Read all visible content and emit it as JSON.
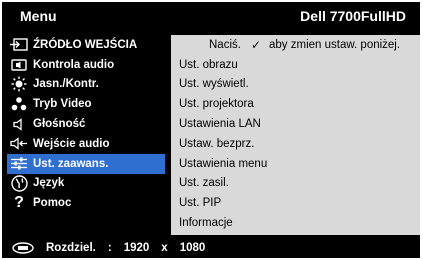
{
  "header": {
    "title": "Menu",
    "model": "Dell 7700FullHD"
  },
  "left_menu": [
    {
      "label": "ŹRÓDŁO WEJŚCIA",
      "icon": "input-source-icon"
    },
    {
      "label": "Kontrola audio",
      "icon": "audio-control-icon"
    },
    {
      "label": "Jasn./Kontr.",
      "icon": "brightness-icon"
    },
    {
      "label": "Tryb Video",
      "icon": "video-mode-icon"
    },
    {
      "label": "Głośność",
      "icon": "speaker-icon"
    },
    {
      "label": "Wejście audio",
      "icon": "audio-input-icon"
    },
    {
      "label": "Ust. zaawans.",
      "icon": "advanced-settings-icon",
      "selected": true
    },
    {
      "label": "Język",
      "icon": "globe-icon"
    },
    {
      "label": "Pomoc",
      "icon": "help-icon"
    }
  ],
  "right_options": {
    "hint_prefix": "Naciś.",
    "hint_suffix": "aby zmien ustaw. poniżej.",
    "items": [
      "Ust. obrazu",
      "Ust. wyświetl.",
      "Ust. projektora",
      "Ustawienia LAN",
      "Ustaw. bezprz.",
      "Ustawienia menu",
      "Ust. zasil.",
      "Ust. PIP",
      "Informacje"
    ]
  },
  "footer": {
    "label": "Rozdziel.",
    "sep": ":",
    "width": "1920",
    "x": "x",
    "height": "1080"
  },
  "colors": {
    "background": "#000000",
    "selection": "#2f6fd0",
    "panel": "#d9d9d9"
  }
}
